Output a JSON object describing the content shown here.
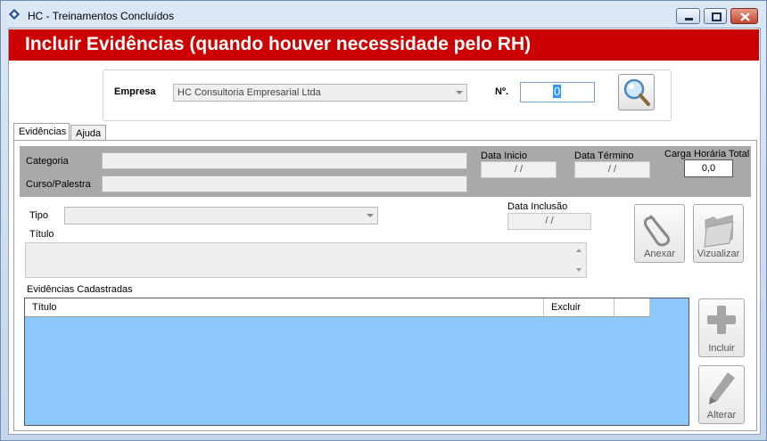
{
  "window": {
    "title": "HC - Treinamentos Concluídos"
  },
  "banner": {
    "title": "Incluir Evidências (quando houver necessidade pelo RH)"
  },
  "company": {
    "label": "Empresa",
    "selected": "HC Consultoria Empresarial Ltda",
    "number_label": "Nº.",
    "number_value": "0"
  },
  "tabs": [
    {
      "label": "Evidências",
      "active": true
    },
    {
      "label": "Ajuda",
      "active": false
    }
  ],
  "course": {
    "categoria_label": "Categoria",
    "curso_label": "Curso/Palestra",
    "data_inicio_label": "Data Inicio",
    "data_inicio_value": "/ /",
    "data_termino_label": "Data Término",
    "data_termino_value": "/ /",
    "carga_label": "Carga Horária Total",
    "carga_value": "0,0"
  },
  "evidence": {
    "tipo_label": "Tipo",
    "data_inclusao_label": "Data Inclusão",
    "data_inclusao_value": "/ /",
    "titulo_label": "Título",
    "anexar_label": "Anexar",
    "vizualizar_label": "Vizualizar"
  },
  "registered": {
    "label": "Evidências Cadastradas",
    "columns": [
      "Título",
      "Excluir",
      ""
    ],
    "incluir_label": "Incluir",
    "alterar_label": "Alterar",
    "grid_color": "#8cc8fa"
  },
  "colors": {
    "banner": "#cc0000",
    "panel_grey": "#a9a9a9"
  }
}
